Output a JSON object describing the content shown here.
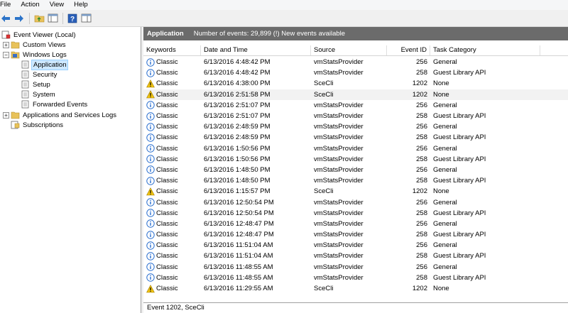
{
  "menu": [
    "File",
    "Action",
    "View",
    "Help"
  ],
  "toolbar": {
    "buttons": [
      "back-icon",
      "forward-icon",
      "up-folder-icon",
      "show-hide-tree-icon",
      "help-icon",
      "properties-icon"
    ]
  },
  "tree": {
    "root": "Event Viewer (Local)",
    "custom_views": "Custom Views",
    "windows_logs": "Windows Logs",
    "application": "Application",
    "security": "Security",
    "setup": "Setup",
    "system": "System",
    "forwarded": "Forwarded Events",
    "apps_services": "Applications and Services Logs",
    "subscriptions": "Subscriptions"
  },
  "header": {
    "title": "Application",
    "info": "Number of events: 29,899 (!) New events available"
  },
  "columns": {
    "keywords": "Keywords",
    "datetime": "Date and Time",
    "source": "Source",
    "event_id": "Event ID",
    "task": "Task Category"
  },
  "events": [
    {
      "level": "info",
      "keywords": "Classic",
      "datetime": "6/13/2016 4:48:42 PM",
      "source": "vmStatsProvider",
      "event_id": "256",
      "task": "General"
    },
    {
      "level": "info",
      "keywords": "Classic",
      "datetime": "6/13/2016 4:48:42 PM",
      "source": "vmStatsProvider",
      "event_id": "258",
      "task": "Guest Library API"
    },
    {
      "level": "warning",
      "keywords": "Classic",
      "datetime": "6/13/2016 4:38:00 PM",
      "source": "SceCli",
      "event_id": "1202",
      "task": "None"
    },
    {
      "level": "warning",
      "keywords": "Classic",
      "datetime": "6/13/2016 2:51:58 PM",
      "source": "SceCli",
      "event_id": "1202",
      "task": "None",
      "selected": true
    },
    {
      "level": "info",
      "keywords": "Classic",
      "datetime": "6/13/2016 2:51:07 PM",
      "source": "vmStatsProvider",
      "event_id": "256",
      "task": "General"
    },
    {
      "level": "info",
      "keywords": "Classic",
      "datetime": "6/13/2016 2:51:07 PM",
      "source": "vmStatsProvider",
      "event_id": "258",
      "task": "Guest Library API"
    },
    {
      "level": "info",
      "keywords": "Classic",
      "datetime": "6/13/2016 2:48:59 PM",
      "source": "vmStatsProvider",
      "event_id": "256",
      "task": "General"
    },
    {
      "level": "info",
      "keywords": "Classic",
      "datetime": "6/13/2016 2:48:59 PM",
      "source": "vmStatsProvider",
      "event_id": "258",
      "task": "Guest Library API"
    },
    {
      "level": "info",
      "keywords": "Classic",
      "datetime": "6/13/2016 1:50:56 PM",
      "source": "vmStatsProvider",
      "event_id": "256",
      "task": "General"
    },
    {
      "level": "info",
      "keywords": "Classic",
      "datetime": "6/13/2016 1:50:56 PM",
      "source": "vmStatsProvider",
      "event_id": "258",
      "task": "Guest Library API"
    },
    {
      "level": "info",
      "keywords": "Classic",
      "datetime": "6/13/2016 1:48:50 PM",
      "source": "vmStatsProvider",
      "event_id": "256",
      "task": "General"
    },
    {
      "level": "info",
      "keywords": "Classic",
      "datetime": "6/13/2016 1:48:50 PM",
      "source": "vmStatsProvider",
      "event_id": "258",
      "task": "Guest Library API"
    },
    {
      "level": "warning",
      "keywords": "Classic",
      "datetime": "6/13/2016 1:15:57 PM",
      "source": "SceCli",
      "event_id": "1202",
      "task": "None"
    },
    {
      "level": "info",
      "keywords": "Classic",
      "datetime": "6/13/2016 12:50:54 PM",
      "source": "vmStatsProvider",
      "event_id": "256",
      "task": "General"
    },
    {
      "level": "info",
      "keywords": "Classic",
      "datetime": "6/13/2016 12:50:54 PM",
      "source": "vmStatsProvider",
      "event_id": "258",
      "task": "Guest Library API"
    },
    {
      "level": "info",
      "keywords": "Classic",
      "datetime": "6/13/2016 12:48:47 PM",
      "source": "vmStatsProvider",
      "event_id": "256",
      "task": "General"
    },
    {
      "level": "info",
      "keywords": "Classic",
      "datetime": "6/13/2016 12:48:47 PM",
      "source": "vmStatsProvider",
      "event_id": "258",
      "task": "Guest Library API"
    },
    {
      "level": "info",
      "keywords": "Classic",
      "datetime": "6/13/2016 11:51:04 AM",
      "source": "vmStatsProvider",
      "event_id": "256",
      "task": "General"
    },
    {
      "level": "info",
      "keywords": "Classic",
      "datetime": "6/13/2016 11:51:04 AM",
      "source": "vmStatsProvider",
      "event_id": "258",
      "task": "Guest Library API"
    },
    {
      "level": "info",
      "keywords": "Classic",
      "datetime": "6/13/2016 11:48:55 AM",
      "source": "vmStatsProvider",
      "event_id": "256",
      "task": "General"
    },
    {
      "level": "info",
      "keywords": "Classic",
      "datetime": "6/13/2016 11:48:55 AM",
      "source": "vmStatsProvider",
      "event_id": "258",
      "task": "Guest Library API"
    },
    {
      "level": "warning",
      "keywords": "Classic",
      "datetime": "6/13/2016 11:29:55 AM",
      "source": "SceCli",
      "event_id": "1202",
      "task": "None"
    }
  ],
  "status": "Event 1202, SceCli",
  "colors": {
    "header_bg": "#6b6b6b",
    "selection": "#cde8ff",
    "info_icon": "#2a6fcf",
    "warning_icon": "#f2c511"
  }
}
